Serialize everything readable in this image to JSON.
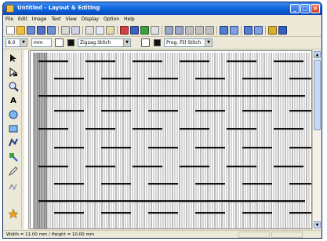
{
  "window": {
    "title": "Untitled - Layout & Editing"
  },
  "menubar": {
    "items": [
      "File",
      "Edit",
      "Image",
      "Text",
      "View",
      "Display",
      "Option",
      "Help"
    ]
  },
  "toolbar2": {
    "size_value": "8.0",
    "mode_value": "mm",
    "stitch_type": "Zigzag Stitch",
    "fill_type": "Prog. Fill Stitch"
  },
  "statusbar": {
    "text": "Width = 11.00 mm / Height = 10.00 mm"
  },
  "colors": {
    "titlebar": "#0a5fd8",
    "stitch_outline": "#222222",
    "stitch_fill": "#8a8a8a"
  }
}
